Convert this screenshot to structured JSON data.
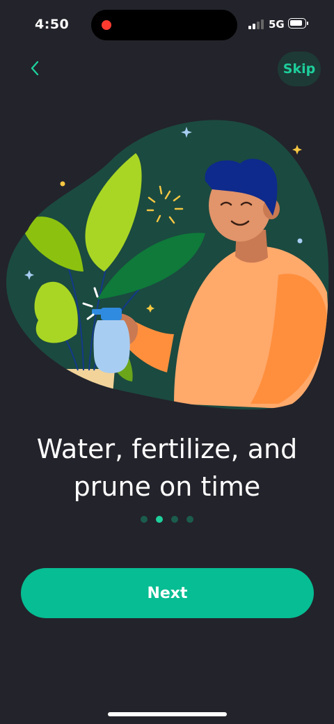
{
  "status_bar": {
    "time": "4:50",
    "network": "5G"
  },
  "header": {
    "skip_label": "Skip"
  },
  "onboarding": {
    "title_line1": "Water, fertilize, and",
    "title_line2": "prune on time",
    "page_count": 4,
    "active_page": 2
  },
  "footer": {
    "next_label": "Next"
  },
  "colors": {
    "background": "#23232b",
    "accent": "#07bd93",
    "accent_light": "#1ecf9c",
    "blob": "#1b4a40"
  },
  "icons": {
    "back": "chevron-left-icon",
    "illustration": "man-watering-plant-illustration"
  }
}
